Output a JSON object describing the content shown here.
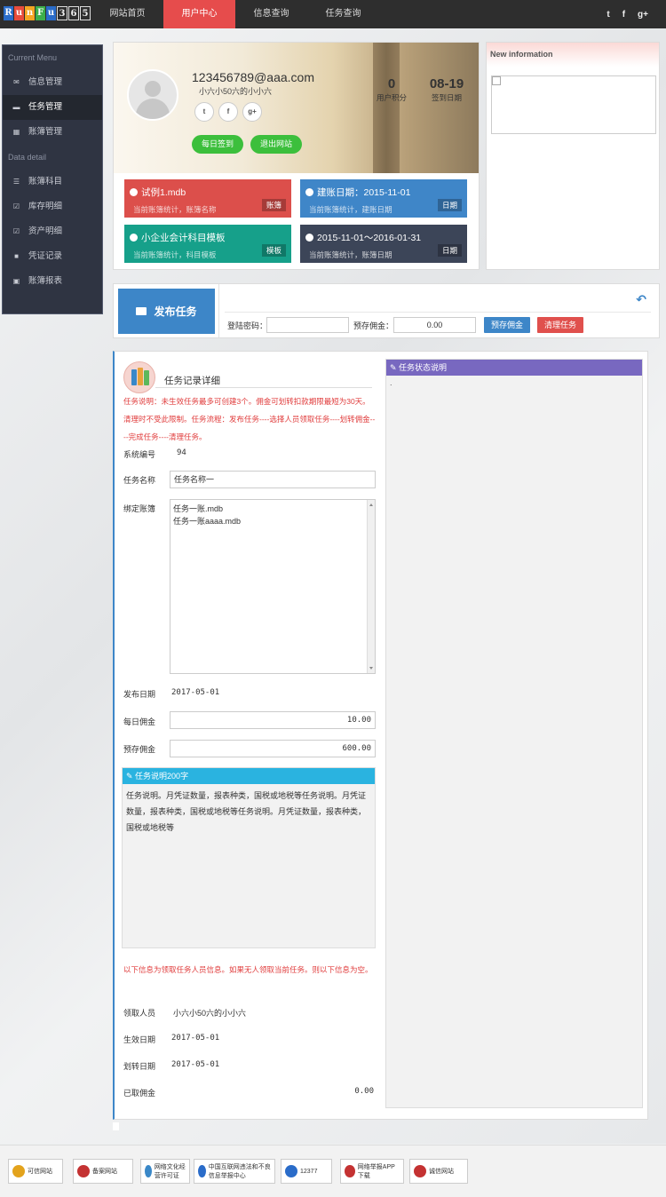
{
  "header": {
    "logo_letters": [
      "R",
      "u",
      "n",
      "F",
      "u",
      "3",
      "6",
      "5"
    ],
    "nav": [
      "网站首页",
      "用户中心",
      "信息查询",
      "任务查询"
    ],
    "nav_active": 1,
    "social": [
      "t",
      "f",
      "g+"
    ]
  },
  "sidebar": {
    "section1": "Current Menu",
    "items1": [
      {
        "label": "信息管理",
        "icon": "envelope-icon"
      },
      {
        "label": "任务管理",
        "icon": "folder-icon",
        "active": true
      },
      {
        "label": "账簿管理",
        "icon": "grid-icon"
      }
    ],
    "section2": "Data detail",
    "items2": [
      {
        "label": "账簿科目",
        "icon": "list-icon"
      },
      {
        "label": "库存明细",
        "icon": "check-square-icon"
      },
      {
        "label": "资产明细",
        "icon": "check-square-icon"
      },
      {
        "label": "凭证记录",
        "icon": "file-icon"
      },
      {
        "label": "账簿报表",
        "icon": "briefcase-icon"
      }
    ]
  },
  "profile": {
    "email": "123456789@aaa.com",
    "name": "小六小50六的小小六",
    "social": [
      "t",
      "f",
      "g+"
    ],
    "btn_checkin": "每日签到",
    "btn_logout": "退出网站",
    "points_value": "0",
    "points_label": "用户积分",
    "checkin_value": "08-19",
    "checkin_label": "签到日期"
  },
  "tiles": [
    {
      "title": "试例1.mdb",
      "sub": "当前账簿统计，账簿名称",
      "badge": "账簿",
      "color": "#dc4f4b"
    },
    {
      "title": "建账日期：2015-11-01",
      "sub": "当前账簿统计，建账日期",
      "badge": "日期",
      "color": "#3f86c8"
    },
    {
      "title": "小企业会计科目模板",
      "sub": "当前账簿统计，科目模板",
      "badge": "模板",
      "color": "#16a08a"
    },
    {
      "title": "2015-11-01～2016-01-31",
      "sub": "当前账簿统计，账簿日期",
      "badge": "日期",
      "color": "#3c4558"
    }
  ],
  "newinfo": {
    "title": "New information"
  },
  "publish": {
    "button": "发布任务",
    "pwd_label": "登陆密码：",
    "pwd_value": "",
    "deposit_label": "预存佣金：",
    "deposit_value": "0.00",
    "btn_deposit": "预存佣金",
    "btn_clear": "清理任务"
  },
  "form": {
    "title": "任务记录详细",
    "warning": "任务说明：未生效任务最多可创建3个。佣金可划转扣款期限最短为30天。清理时不受此限制。任务流程：发布任务----选择人员领取任务----划转佣金----完成任务----清理任务。",
    "id_label": "系统编号",
    "id_value": "94",
    "name_label": "任务名称",
    "name_value": "任务名称一",
    "book_label": "绑定账簿",
    "books": [
      "任务一账.mdb",
      "任务一账aaaa.mdb"
    ],
    "pub_date_label": "发布日期",
    "pub_date_value": "2017-05-01",
    "daily_label": "每日佣金",
    "daily_value": "10.00",
    "deposit_label": "预存佣金",
    "deposit_value": "600.00",
    "desc_title": "任务说明200字",
    "desc_text": "任务说明。月凭证数量，报表种类，国税或地税等任务说明。月凭证数量，报表种类，国税或地税等任务说明。月凭证数量，报表种类，国税或地税等",
    "notice": "以下信息为领取任务人员信息。如果无人领取当前任务。则以下信息为空。",
    "receiver_label": "领取人员",
    "receiver_value": "小六小50六的小小六",
    "effect_label": "生效日期",
    "effect_value": "2017-05-01",
    "transfer_label": "划转日期",
    "transfer_value": "2017-05-01",
    "taken_label": "已取佣金",
    "taken_value": "0.00"
  },
  "status_panel": {
    "title": "任务状态说明",
    "body": "."
  },
  "footer": {
    "badges": [
      "可信网站",
      "备案网站",
      "网络文化经营许可证",
      "中国互联网违法和不良信息举报中心",
      "12377",
      "网络举报APP下载",
      "诚信网站"
    ]
  }
}
